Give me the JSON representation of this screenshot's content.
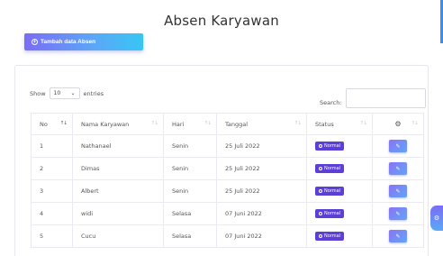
{
  "page": {
    "title": "Absen Karyawan"
  },
  "toolbar": {
    "add_label": "Tambah data Absen",
    "add_icon": "plus-circle-icon"
  },
  "table_controls": {
    "show_label": "Show",
    "entries_value": "10",
    "entries_label": "entries",
    "search_label": "Search:",
    "search_value": ""
  },
  "table": {
    "headers": {
      "no": "No",
      "nama": "Nama Karyawan",
      "hari": "Hari",
      "tanggal": "Tanggal",
      "status": "Status",
      "action_icon": "gear-icon"
    },
    "rows": [
      {
        "no": "1",
        "nama": "Nathanael",
        "hari": "Senin",
        "tanggal": "25 Juli 2022",
        "status": "Normal"
      },
      {
        "no": "2",
        "nama": "Dimas",
        "hari": "Senin",
        "tanggal": "25 Juli 2022",
        "status": "Normal"
      },
      {
        "no": "3",
        "nama": "Albert",
        "hari": "Senin",
        "tanggal": "25 Juli 2022",
        "status": "Normal"
      },
      {
        "no": "4",
        "nama": "widi",
        "hari": "Selasa",
        "tanggal": "07 Juni 2022",
        "status": "Normal"
      },
      {
        "no": "5",
        "nama": "Cucu",
        "hari": "Selasa",
        "tanggal": "07 Juni 2022",
        "status": "Normal"
      }
    ]
  },
  "colors": {
    "accent_start": "#7b6cf6",
    "accent_end": "#36c6f4",
    "badge": "#5b3fd6"
  }
}
